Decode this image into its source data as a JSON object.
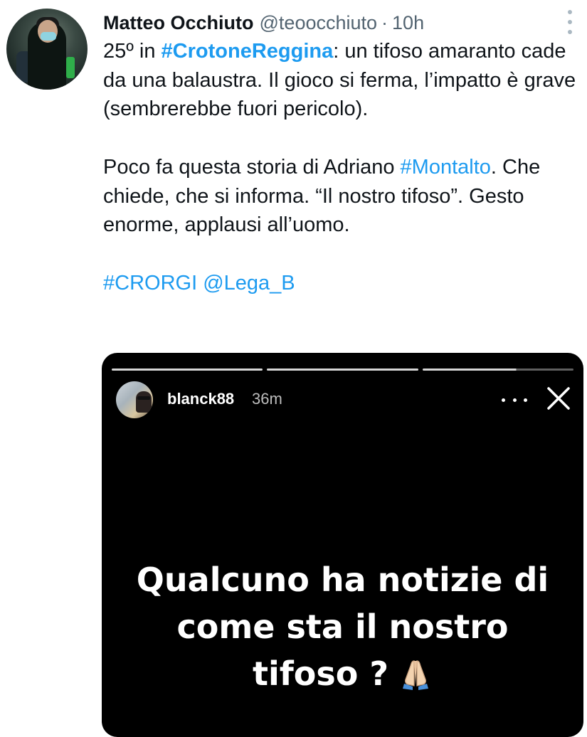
{
  "tweet": {
    "author_name": "Matteo Occhiuto",
    "author_handle": "@teoocchiuto",
    "separator": "·",
    "time": "10h",
    "p1": {
      "prefix": "25º in ",
      "hashtag": "#CrotoneReggina",
      "rest": ": un tifoso amaranto cade da una balaustra. Il gioco si ferma, l’impatto è grave (sembrerebbe fuori pericolo)."
    },
    "p2": {
      "prefix": "Poco fa questa storia di Adriano ",
      "hashtag": "#Montalto",
      "rest": ". Che chiede, che si informa. “Il nostro tifoso”. Gesto enorme, applausi all’uomo."
    },
    "p3": {
      "hashtag": "#CRORGI",
      "space": " ",
      "mention": "@Lega_B"
    }
  },
  "story": {
    "username": "blanck88",
    "time": "36m",
    "lines": [
      "Qualcuno ha notizie di",
      "come sta il nostro",
      "tifoso ?"
    ],
    "emoji": "folded-hands-icon"
  },
  "colors": {
    "link": "#1d9bf0",
    "secondary_text": "#536471",
    "story_bg": "#000000"
  }
}
